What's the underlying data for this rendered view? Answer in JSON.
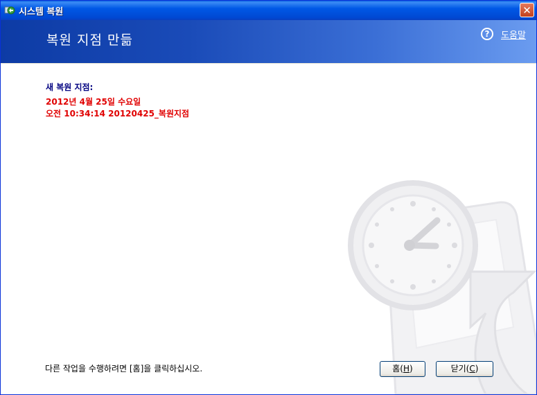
{
  "window": {
    "title": "시스템 복원",
    "close_glyph": "✕"
  },
  "header": {
    "title": "복원 지점 만듦",
    "help_label": "도움말",
    "help_glyph": "?"
  },
  "content": {
    "new_point_label": "새 복원 지점:",
    "date": "2012년 4월 25일 수요일",
    "time_and_name": "오전 10:34:14  20120425_복원지점",
    "instruction": "다른 작업을 수행하려면 [홈]을 클릭하십시오."
  },
  "buttons": {
    "home": {
      "label": "홈(",
      "key": "H",
      "suffix": ")"
    },
    "close": {
      "label": "닫기(",
      "key": "C",
      "suffix": ")"
    }
  },
  "colors": {
    "title_bar": "#0058e6",
    "header_start": "#0d3ba5",
    "header_end": "#6b9cf0",
    "accent_text": "#e00000",
    "label_text": "#000080"
  },
  "icons": {
    "app": "system-restore-icon",
    "help": "help-question-icon",
    "close": "close-icon"
  }
}
